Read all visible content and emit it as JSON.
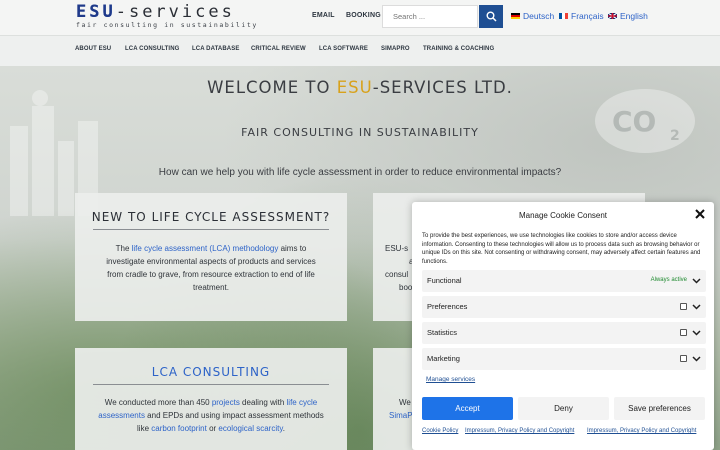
{
  "header": {
    "logo": {
      "brand_esu": "ESU",
      "brand_rest": "-services",
      "tagline": "fair consulting in sustainability"
    },
    "top_nav": [
      "EMAIL",
      "BOOKING"
    ],
    "search": {
      "placeholder": "Search ..."
    },
    "languages": [
      {
        "label": "Deutsch",
        "flag": "flag-de"
      },
      {
        "label": "Français",
        "flag": "flag-fr"
      },
      {
        "label": "English",
        "flag": "flag-en"
      }
    ]
  },
  "main_nav": [
    "ABOUT ESU",
    "LCA CONSULTING",
    "LCA DATABASE",
    "CRITICAL REVIEW",
    "LCA SOFTWARE",
    "SIMAPRO",
    "TRAINING & COACHING"
  ],
  "hero": {
    "title_prefix": "WELCOME TO ",
    "title_brand": "ESU",
    "title_suffix": "-SERVICES LTD.",
    "subtitle": "FAIR CONSULTING IN SUSTAINABILITY",
    "question": "How can we help you with life cycle assessment in order to reduce environmental impacts?"
  },
  "cards": {
    "new_lca": {
      "title": "NEW TO LIFE CYCLE ASSESSMENT?",
      "t1": "The ",
      "link1": "life cycle assessment (LCA) methodology",
      "t2": " aims to investigate environmental aspects of products and services from cradle to grave, from resource extraction to end of life treatment."
    },
    "right_top": {
      "lines": [
        "ESU-s",
        "a",
        "consul",
        "boo"
      ]
    },
    "lca_consulting": {
      "title": "LCA CONSULTING",
      "t1": "We conducted more than 450 ",
      "link1": "projects",
      "t2": " dealing with ",
      "link2": "life cycle assessments",
      "t3": " and EPDs and using impact assessment methods like ",
      "link3": "carbon footprint",
      "t4": " or ",
      "link4": "ecological scarcity",
      "t5": "."
    },
    "right_bottom": {
      "line1": "We",
      "link1": "SimaP"
    }
  },
  "cookie": {
    "title": "Manage Cookie Consent",
    "description": "To provide the best experiences, we use technologies like cookies to store and/or access device information. Consenting to these technologies will allow us to process data such as browsing behavior or unique IDs on this site. Not consenting or withdrawing consent, may adversely affect certain features and functions.",
    "categories": [
      {
        "label": "Functional",
        "status": "Always active"
      },
      {
        "label": "Preferences"
      },
      {
        "label": "Statistics"
      },
      {
        "label": "Marketing"
      }
    ],
    "manage_link": "Manage services",
    "buttons": {
      "accept": "Accept",
      "deny": "Deny",
      "save": "Save preferences"
    },
    "footer_links": [
      "Cookie Policy",
      "Impressum, Privacy Policy and Copyright",
      "Impressum, Privacy Policy and Copyright"
    ]
  },
  "colors": {
    "brand_blue": "#1f4f93",
    "link_blue": "#2d63c8",
    "accent_gold": "#d8a21c",
    "accept_blue": "#1e73e8",
    "active_green": "#1e8a2f"
  }
}
